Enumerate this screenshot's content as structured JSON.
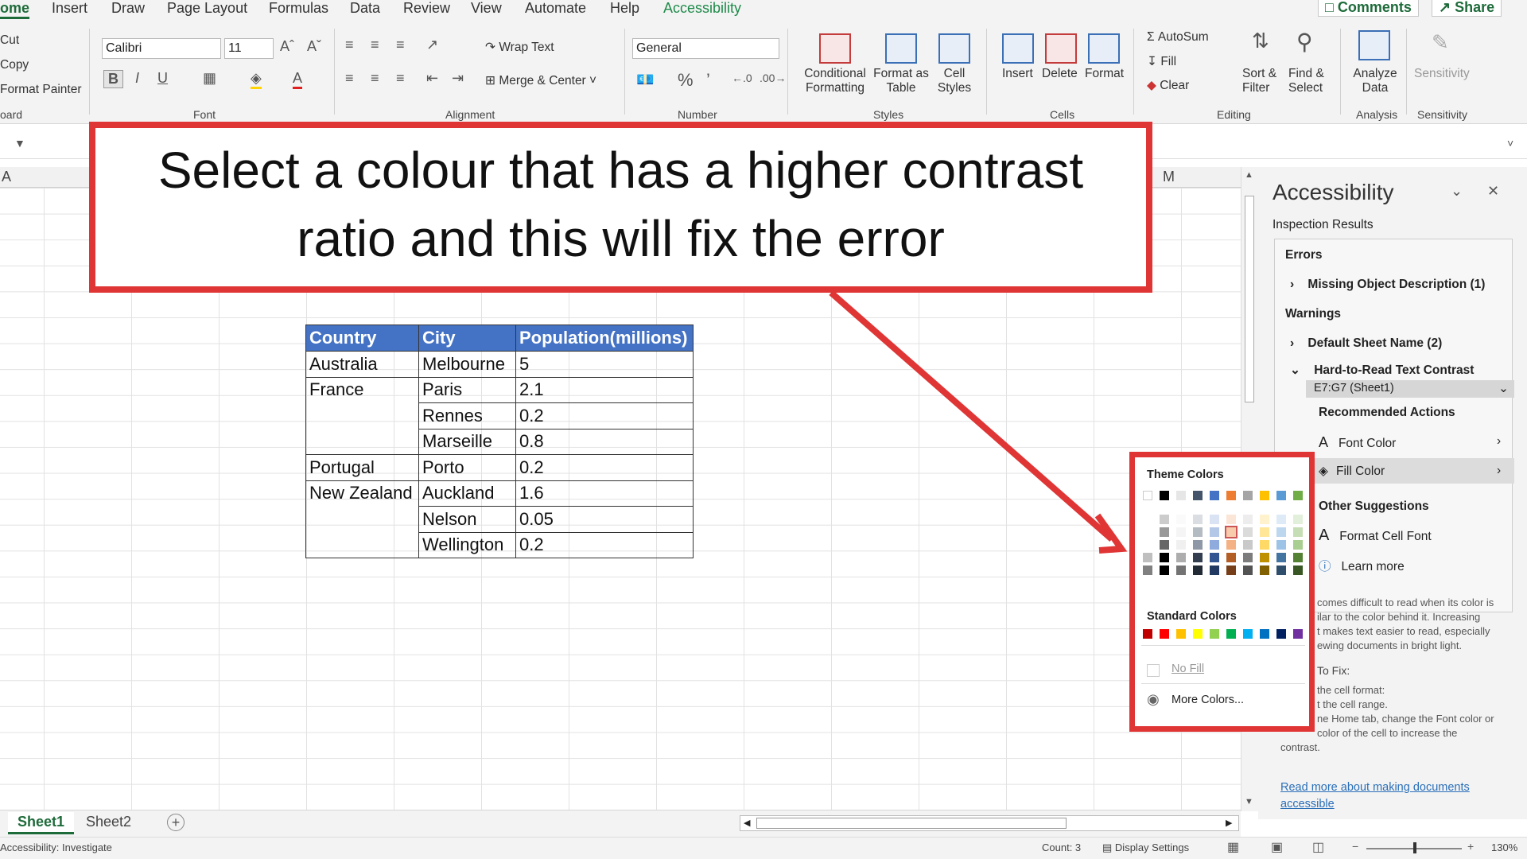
{
  "tabs": [
    "ome",
    "Insert",
    "Draw",
    "Page Layout",
    "Formulas",
    "Data",
    "Review",
    "View",
    "Automate",
    "Help",
    "Accessibility"
  ],
  "top_buttons": {
    "comments": "Comments",
    "share": "Share"
  },
  "clipboard": {
    "cut": "Cut",
    "copy": "Copy",
    "format_painter": "Format Painter",
    "group": "oard"
  },
  "font": {
    "name": "Calibri",
    "size": "11",
    "group": "Font"
  },
  "alignment": {
    "wrap": "Wrap Text",
    "merge": "Merge & Center",
    "group": "Alignment"
  },
  "number": {
    "format": "General",
    "group": "Number"
  },
  "styles": {
    "conditional": [
      "Conditional",
      "Formatting"
    ],
    "format_table": [
      "Format as",
      "Table"
    ],
    "cell_styles": [
      "Cell",
      "Styles"
    ],
    "group": "Styles"
  },
  "cells": {
    "insert": "Insert",
    "delete": "Delete",
    "format": "Format",
    "group": "Cells"
  },
  "editing": {
    "autosum": "AutoSum",
    "fill": "Fill",
    "clear": "Clear",
    "sort": [
      "Sort &",
      "Filter"
    ],
    "find": [
      "Find &",
      "Select"
    ],
    "group": "Editing"
  },
  "analysis": {
    "analyze": [
      "Analyze",
      "Data"
    ],
    "group": "Analysis"
  },
  "sensitivity": {
    "label": "Sensitivity",
    "group": "Sensitivity"
  },
  "colhdr": {
    "a": "A",
    "m": "M"
  },
  "callout": {
    "line1": "Select a colour that has a higher contrast",
    "line2": "ratio and this will fix the error"
  },
  "table": {
    "headers": [
      "Country",
      "City",
      "Population(millions)"
    ],
    "rows": [
      [
        "Australia",
        "Melbourne",
        "5"
      ],
      [
        "France",
        "Paris",
        "2.1"
      ],
      [
        "",
        "Rennes",
        "0.2"
      ],
      [
        "",
        "Marseille",
        "0.8"
      ],
      [
        "Portugal",
        "Porto",
        "0.2"
      ],
      [
        "New Zealand",
        "Auckland",
        "1.6"
      ],
      [
        "",
        "Nelson",
        "0.05"
      ],
      [
        "",
        "Wellington",
        "0.2"
      ]
    ],
    "header_color": "#4472c4"
  },
  "palette": {
    "theme": "Theme Colors",
    "standard": "Standard Colors",
    "no_fill": "No Fill",
    "more": "More Colors...",
    "theme_row": [
      "#ffffff",
      "#000000",
      "#e7e6e6",
      "#44546a",
      "#4472c4",
      "#ed7d31",
      "#a5a5a5",
      "#ffc000",
      "#5b9bd5",
      "#70ad47"
    ],
    "standard_row": [
      "#c00000",
      "#ff0000",
      "#ffc000",
      "#ffff00",
      "#92d050",
      "#00b050",
      "#00b0f0",
      "#0070c0",
      "#002060",
      "#7030a0"
    ]
  },
  "pane": {
    "title": "Accessibility",
    "inspection": "Inspection Results",
    "errors": "Errors",
    "missing": "Missing Object Description (1)",
    "warnings": "Warnings",
    "default_name": "Default Sheet Name (2)",
    "contrast": "Hard-to-Read Text Contrast",
    "range": "E7:G7 (Sheet1)",
    "recommended": "Recommended Actions",
    "font_color": "Font Color",
    "fill_color": "Fill Color",
    "other": "Other Suggestions",
    "format_font": "Format Cell Font",
    "learn": "Learn more",
    "why": [
      "comes difficult to read when its color is",
      "ilar to the color behind it. Increasing",
      "t makes text easier to read, especially",
      "ewing documents in bright light."
    ],
    "howto": "To Fix:",
    "steps": [
      "the cell format:",
      "t the cell range.",
      "ne Home tab, change the Font color or",
      "color of the cell to increase the",
      "contrast."
    ],
    "readmore": [
      "Read more about making documents",
      "accessible"
    ]
  },
  "sheets": [
    "Sheet1",
    "Sheet2"
  ],
  "status": {
    "left": "Accessibility: Investigate",
    "count": "Count: 3",
    "display": "Display Settings",
    "zoom": "130%"
  }
}
